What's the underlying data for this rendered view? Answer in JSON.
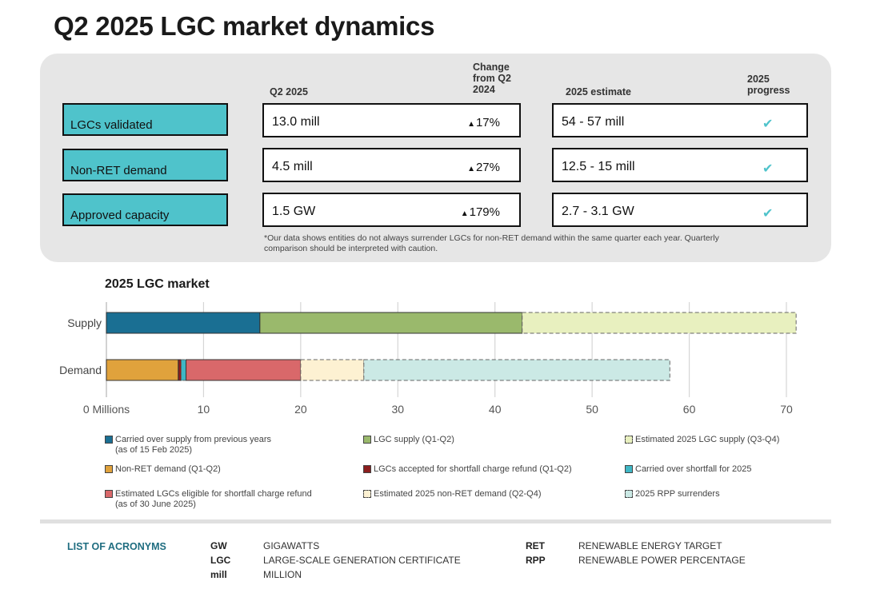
{
  "title": "Q2 2025 LGC market dynamics",
  "table": {
    "headers": {
      "q2": "Q2 2025",
      "change_l1": "Change",
      "change_l2": "from Q2",
      "change_l3": "2024",
      "estimate": "2025 estimate",
      "progress_l1": "2025",
      "progress_l2": "progress"
    },
    "rows": [
      {
        "label": "LGCs validated",
        "q2": "13.0 mill",
        "change": "17%",
        "estimate": "54 - 57 mill",
        "progress": "✔"
      },
      {
        "label": "Non-RET demand",
        "q2": "4.5 mill",
        "change": "27%",
        "estimate": "12.5 - 15 mill",
        "progress": "✔"
      },
      {
        "label": "Approved capacity",
        "q2": "1.5 GW",
        "change": "179%",
        "estimate": "2.7 - 3.1 GW",
        "progress": "✔"
      }
    ],
    "up_symbol": "▲",
    "note": "*Our data shows entities do not always surrender LGCs for non-RET demand within the same quarter each year. Quarterly comparison should be interpreted with caution."
  },
  "chart_data": {
    "type": "bar",
    "orientation": "horizontal",
    "stacked": true,
    "title": "2025 LGC market",
    "categories": [
      "Supply",
      "Demand"
    ],
    "x_ticks": [
      "0 Millions",
      "10",
      "20",
      "30",
      "40",
      "50",
      "60",
      "70"
    ],
    "xlim": [
      0,
      70
    ],
    "grid": true,
    "series": [
      {
        "name": "Carried over supply from previous years (as of 15 Feb 2025)",
        "category": "Supply",
        "value": 15.8,
        "color": "#1a6f93",
        "dashed": false
      },
      {
        "name": "LGC supply (Q1-Q2)",
        "category": "Supply",
        "value": 27.0,
        "color": "#9ab96c",
        "dashed": false
      },
      {
        "name": "Estimated 2025 LGC supply (Q3-Q4)",
        "category": "Supply",
        "value": 28.2,
        "color": "#e8f0bf",
        "dashed": true
      },
      {
        "name": "Non-RET demand (Q1-Q2)",
        "category": "Demand",
        "value": 7.4,
        "color": "#e0a23c",
        "dashed": false
      },
      {
        "name": "LGCs accepted for shortfall charge refund (Q1-Q2)",
        "category": "Demand",
        "value": 0.3,
        "color": "#8b1e1e",
        "dashed": false
      },
      {
        "name": "Carried over shortfall for 2025",
        "category": "Demand",
        "value": 0.5,
        "color": "#3fb7c5",
        "dashed": true
      },
      {
        "name": "Estimated LGCs eligible for shortfall charge refund (as of 30 June 2025)",
        "category": "Demand",
        "value": 11.8,
        "color": "#d9686a",
        "dashed": false
      },
      {
        "name": "Estimated 2025 non-RET demand (Q2-Q4)",
        "category": "Demand",
        "value": 6.5,
        "color": "#fdf1d2",
        "dashed": true
      },
      {
        "name": "2025 RPP surrenders",
        "category": "Demand",
        "value": 31.5,
        "color": "#cbe9e5",
        "dashed": true
      }
    ]
  },
  "legend": [
    {
      "label_l1": "Carried over supply from previous years",
      "label_l2": "(as of 15 Feb 2025)",
      "color": "#1a6f93",
      "dashed": false
    },
    {
      "label_l1": "LGC supply (Q1-Q2)",
      "label_l2": "",
      "color": "#9ab96c",
      "dashed": false
    },
    {
      "label_l1": "Estimated 2025 LGC supply (Q3-Q4)",
      "label_l2": "",
      "color": "#e8f0bf",
      "dashed": true
    },
    {
      "label_l1": "Non-RET demand (Q1-Q2)",
      "label_l2": "",
      "color": "#e0a23c",
      "dashed": false
    },
    {
      "label_l1": "LGCs accepted for shortfall charge refund (Q1-Q2)",
      "label_l2": "",
      "color": "#8b1e1e",
      "dashed": false
    },
    {
      "label_l1": "Carried over shortfall for 2025",
      "label_l2": "",
      "color": "#3fb7c5",
      "dashed": false
    },
    {
      "label_l1": "Estimated LGCs eligible for shortfall charge refund",
      "label_l2": "(as of 30 June 2025)",
      "color": "#d9686a",
      "dashed": false
    },
    {
      "label_l1": "Estimated 2025 non-RET demand (Q2-Q4)",
      "label_l2": "",
      "color": "#fdf1d2",
      "dashed": true
    },
    {
      "label_l1": "2025 RPP surrenders",
      "label_l2": "",
      "color": "#cbe9e5",
      "dashed": true
    }
  ],
  "acronyms": {
    "title": "LIST OF ACRONYMS",
    "items": [
      {
        "abbr": "GW",
        "full": "GIGAWATTS"
      },
      {
        "abbr": "LGC",
        "full": "LARGE-SCALE GENERATION CERTIFICATE"
      },
      {
        "abbr": "mill",
        "full": "MILLION"
      },
      {
        "abbr": "RET",
        "full": "RENEWABLE ENERGY TARGET"
      },
      {
        "abbr": "RPP",
        "full": "RENEWABLE POWER PERCENTAGE"
      }
    ]
  }
}
